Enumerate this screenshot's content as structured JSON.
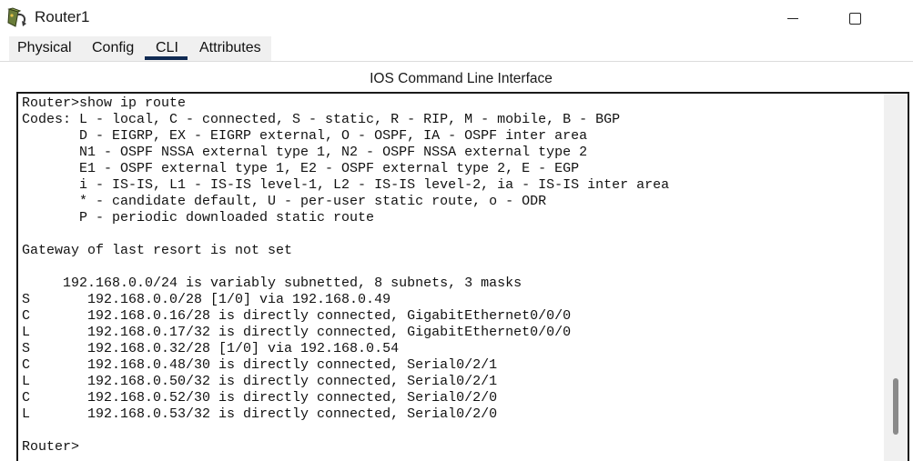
{
  "window": {
    "title": "Router1"
  },
  "tabs": [
    {
      "label": "Physical"
    },
    {
      "label": "Config"
    },
    {
      "label": "CLI"
    },
    {
      "label": "Attributes"
    }
  ],
  "active_tab": "CLI",
  "section_title": "IOS Command Line Interface",
  "terminal": {
    "output": "Router>show ip route\nCodes: L - local, C - connected, S - static, R - RIP, M - mobile, B - BGP\n       D - EIGRP, EX - EIGRP external, O - OSPF, IA - OSPF inter area\n       N1 - OSPF NSSA external type 1, N2 - OSPF NSSA external type 2\n       E1 - OSPF external type 1, E2 - OSPF external type 2, E - EGP\n       i - IS-IS, L1 - IS-IS level-1, L2 - IS-IS level-2, ia - IS-IS inter area\n       * - candidate default, U - per-user static route, o - ODR\n       P - periodic downloaded static route\n\nGateway of last resort is not set\n\n     192.168.0.0/24 is variably subnetted, 8 subnets, 3 masks\nS       192.168.0.0/28 [1/0] via 192.168.0.49\nC       192.168.0.16/28 is directly connected, GigabitEthernet0/0/0\nL       192.168.0.17/32 is directly connected, GigabitEthernet0/0/0\nS       192.168.0.32/28 [1/0] via 192.168.0.54\nC       192.168.0.48/30 is directly connected, Serial0/2/1\nL       192.168.0.50/32 is directly connected, Serial0/2/1\nC       192.168.0.52/30 is directly connected, Serial0/2/0\nL       192.168.0.53/32 is directly connected, Serial0/2/0\n\nRouter>"
  },
  "icons": {
    "app": "router-icon",
    "minimize": "minimize-icon",
    "maximize": "maximize-icon"
  },
  "colors": {
    "active_tab_underline": "#0f2a52",
    "scrollbar_thumb": "#8a8a8a"
  }
}
